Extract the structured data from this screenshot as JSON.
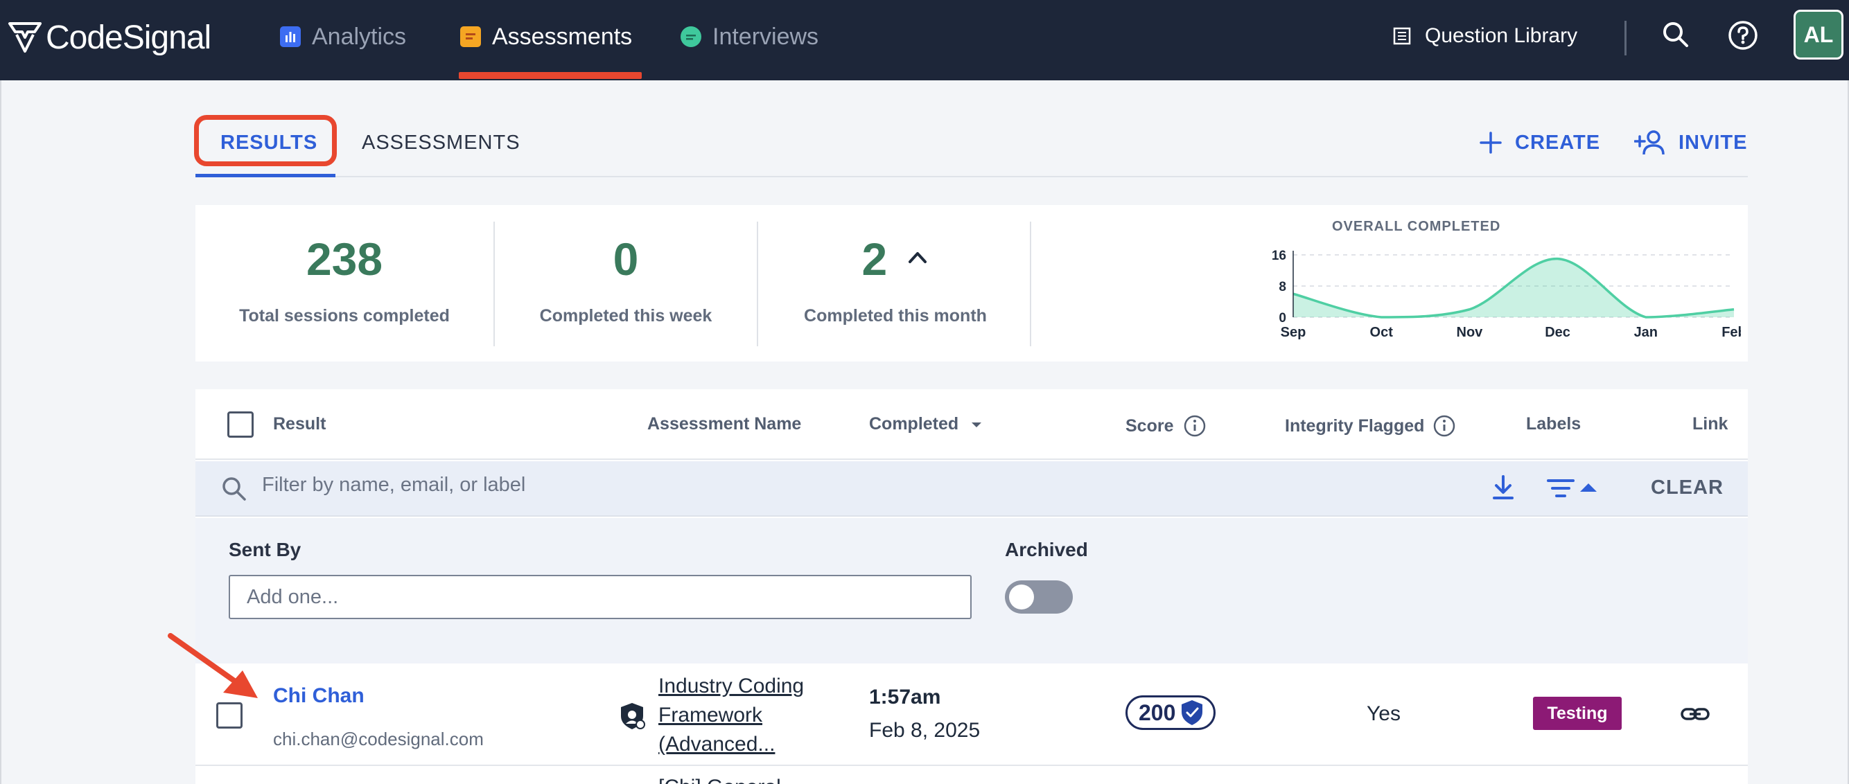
{
  "nav": {
    "logo_text": "CodeSignal",
    "items": [
      {
        "label": "Analytics",
        "icon": "analytics-icon",
        "color": "#3d6df2"
      },
      {
        "label": "Assessments",
        "icon": "assessments-icon",
        "color": "#f5a623",
        "active": true
      },
      {
        "label": "Interviews",
        "icon": "interviews-icon",
        "color": "#3fc89c"
      }
    ],
    "question_library": "Question Library",
    "avatar_initials": "AL"
  },
  "tabs": {
    "results": "RESULTS",
    "assessments": "ASSESSMENTS"
  },
  "actions": {
    "create": "CREATE",
    "invite": "INVITE"
  },
  "stats": {
    "total": {
      "value": "238",
      "label": "Total sessions completed"
    },
    "week": {
      "value": "0",
      "label": "Completed this week"
    },
    "month": {
      "value": "2",
      "label": "Completed this month"
    }
  },
  "chart_data": {
    "type": "area",
    "title": "OVERALL COMPLETED",
    "x": [
      "Sep",
      "Oct",
      "Nov",
      "Dec",
      "Jan",
      "Feb"
    ],
    "y_ticks": [
      0,
      8,
      16
    ],
    "ylim": [
      0,
      16
    ],
    "values": [
      6,
      0,
      2,
      15,
      0,
      2
    ],
    "color": "#4fcfa3"
  },
  "table": {
    "headers": {
      "result": "Result",
      "assessment_name": "Assessment Name",
      "completed": "Completed",
      "score": "Score",
      "integrity": "Integrity Flagged",
      "labels": "Labels",
      "link": "Link"
    },
    "filter_placeholder": "Filter by name, email, or label",
    "clear": "CLEAR",
    "filters": {
      "sent_by_label": "Sent By",
      "sent_by_placeholder": "Add one...",
      "archived_label": "Archived"
    },
    "rows": [
      {
        "name": "Chi Chan",
        "email": "chi.chan@codesignal.com",
        "assessment": "Industry Coding Framework (Advanced...",
        "time": "1:57am",
        "date": "Feb 8, 2025",
        "score": "200",
        "flagged": "Yes",
        "label": "Testing"
      }
    ],
    "next_row_peek": "[Chi] General"
  }
}
